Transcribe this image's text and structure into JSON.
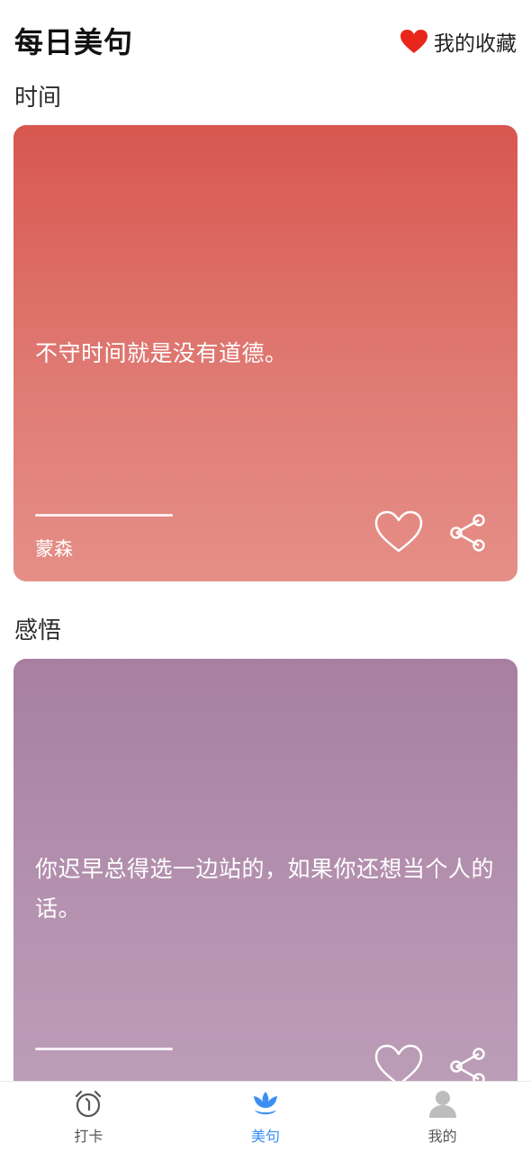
{
  "header": {
    "title": "每日美句",
    "favorites_label": "我的收藏",
    "favorites_icon": "heart-icon",
    "favorites_icon_color": "#e8261c"
  },
  "sections": [
    {
      "title": "时间",
      "card": {
        "color_top": "#d8574f",
        "color_bottom": "#e58f87",
        "quote": "不守时间就是没有道德。",
        "author": "蒙森",
        "like_icon": "heart-outline-icon",
        "share_icon": "share-icon"
      }
    },
    {
      "title": "感悟",
      "card": {
        "color_top": "#a87fa1",
        "color_bottom": "#bd9fb9",
        "quote": "你迟早总得选一边站的，如果你还想当个人的话。",
        "like_icon": "heart-outline-icon",
        "share_icon": "share-icon"
      }
    }
  ],
  "tabbar": {
    "active_color": "#3c8ff2",
    "items": [
      {
        "label": "打卡",
        "icon": "alarm-clock-icon",
        "active": false
      },
      {
        "label": "美句",
        "icon": "lotus-icon",
        "active": true
      },
      {
        "label": "我的",
        "icon": "user-icon",
        "active": false
      }
    ]
  }
}
